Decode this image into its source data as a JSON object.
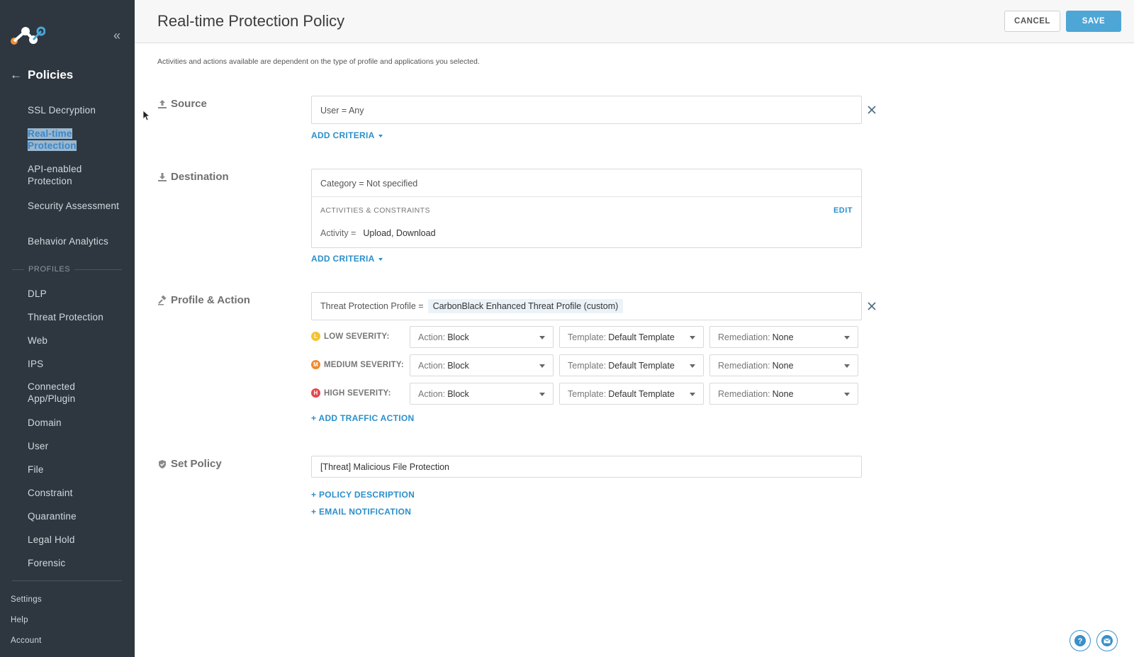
{
  "sidebar": {
    "title": "Policies",
    "items": [
      {
        "label": "SSL Decryption"
      },
      {
        "label": "Real-time Protection"
      },
      {
        "label": "API-enabled Protection"
      },
      {
        "label": "Security Assessment"
      },
      {
        "label": "Behavior Analytics"
      }
    ],
    "profiles_label": "PROFILES",
    "profiles": [
      {
        "label": "DLP"
      },
      {
        "label": "Threat Protection"
      },
      {
        "label": "Web"
      },
      {
        "label": "IPS"
      },
      {
        "label": "Connected App/Plugin"
      },
      {
        "label": "Domain"
      },
      {
        "label": "User"
      },
      {
        "label": "File"
      },
      {
        "label": "Constraint"
      },
      {
        "label": "Quarantine"
      },
      {
        "label": "Legal Hold"
      },
      {
        "label": "Forensic"
      }
    ],
    "footer": [
      {
        "label": "Settings"
      },
      {
        "label": "Help"
      },
      {
        "label": "Account"
      }
    ]
  },
  "header": {
    "title": "Real-time Protection Policy",
    "cancel_label": "CANCEL",
    "save_label": "SAVE"
  },
  "intro": "Activities and actions available are dependent on the type of profile and applications you selected.",
  "source": {
    "label": "Source",
    "value": "User = Any",
    "add_criteria": "ADD CRITERIA"
  },
  "destination": {
    "label": "Destination",
    "value": "Category = Not specified",
    "ac_header": "ACTIVITIES & CONSTRAINTS",
    "edit": "EDIT",
    "activity_key": "Activity =",
    "activity_value": "Upload, Download",
    "add_criteria": "ADD CRITERIA"
  },
  "profile": {
    "label": "Profile & Action",
    "key": "Threat Protection Profile =",
    "value": "CarbonBlack Enhanced Threat Profile (custom)",
    "severities": [
      {
        "badge": "L",
        "label": "LOW SEVERITY:",
        "color": "#f5c330",
        "action_key": "Action:",
        "action": "Block",
        "template_key": "Template:",
        "template": "Default Template",
        "remediation_key": "Remediation:",
        "remediation": "None"
      },
      {
        "badge": "M",
        "label": "MEDIUM SEVERITY:",
        "color": "#ef8a2f",
        "action_key": "Action:",
        "action": "Block",
        "template_key": "Template:",
        "template": "Default Template",
        "remediation_key": "Remediation:",
        "remediation": "None"
      },
      {
        "badge": "H",
        "label": "HIGH SEVERITY:",
        "color": "#e5484d",
        "action_key": "Action:",
        "action": "Block",
        "template_key": "Template:",
        "template": "Default Template",
        "remediation_key": "Remediation:",
        "remediation": "None"
      }
    ],
    "add_traffic_action": "+ ADD TRAFFIC ACTION"
  },
  "set_policy": {
    "label": "Set Policy",
    "name": "[Threat] Malicious File Protection",
    "policy_description": "+ POLICY DESCRIPTION",
    "email_notification": "+ EMAIL NOTIFICATION"
  },
  "colors": {
    "sidebar_bg": "#2e3740",
    "accent": "#2b8fca",
    "save_button": "#4da6d6"
  }
}
